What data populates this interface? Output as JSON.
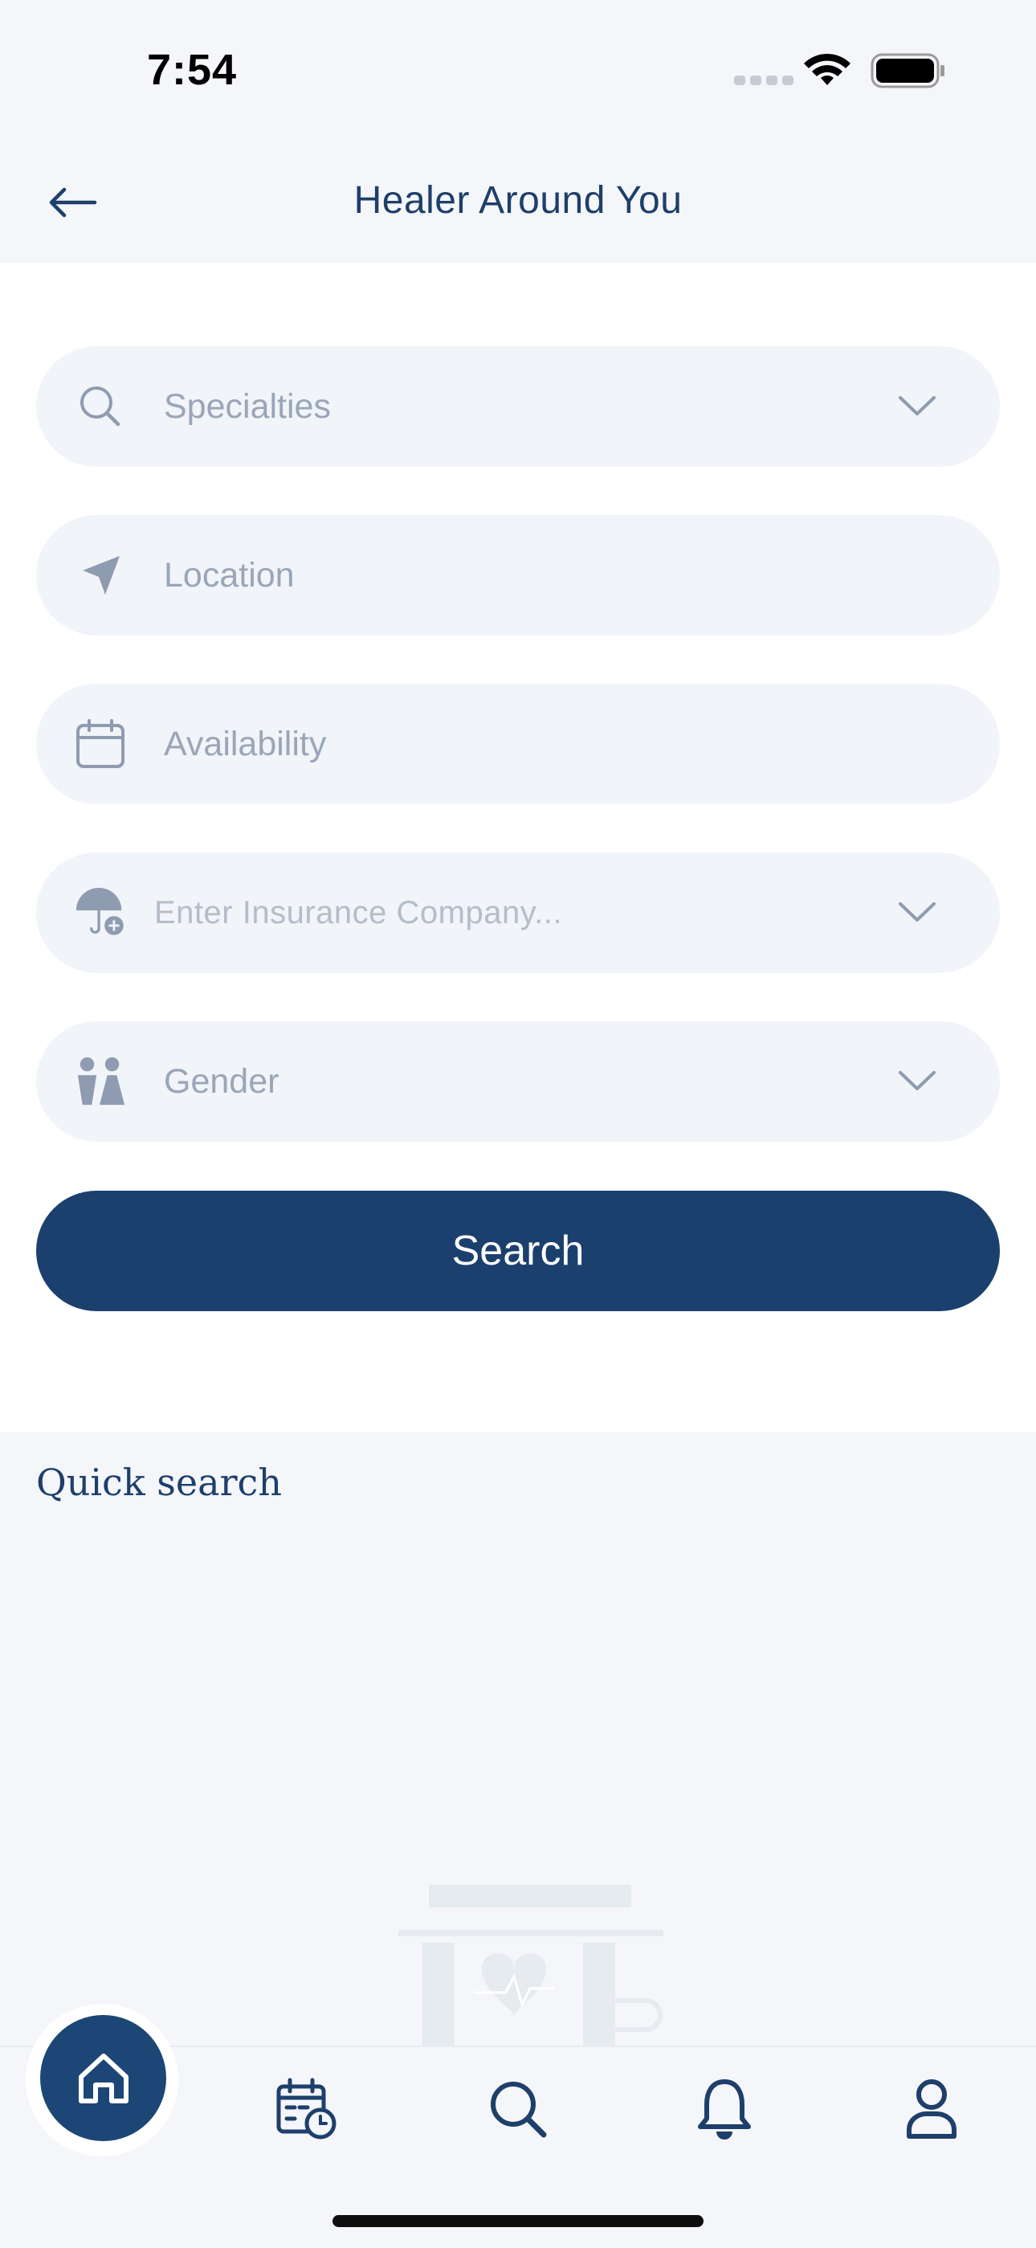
{
  "status_bar": {
    "time": "7:54"
  },
  "header": {
    "title": "Healer Around You",
    "back_icon": "arrow-left-icon"
  },
  "form": {
    "specialties": {
      "placeholder": "Specialties",
      "icon": "search-icon"
    },
    "location": {
      "placeholder": "Location",
      "icon": "location-arrow-icon"
    },
    "availability": {
      "placeholder": "Availability",
      "icon": "calendar-icon"
    },
    "insurance": {
      "placeholder": "Enter Insurance Company...",
      "icon": "umbrella-heart-icon"
    },
    "gender": {
      "placeholder": "Gender",
      "icon": "gender-icon"
    },
    "search_label": "Search"
  },
  "quick_search": {
    "title": "Quick search"
  },
  "tab_bar": {
    "items": [
      {
        "name": "home",
        "icon": "home-icon",
        "active": true
      },
      {
        "name": "appointments",
        "icon": "calendar-clock-icon"
      },
      {
        "name": "search",
        "icon": "search-icon"
      },
      {
        "name": "notifications",
        "icon": "bell-icon"
      },
      {
        "name": "profile",
        "icon": "user-icon"
      }
    ]
  },
  "colors": {
    "primary": "#1c406d",
    "field_bg": "#f1f4f8",
    "placeholder": "#9aa6b8",
    "page_bg": "#f4f6f9"
  }
}
